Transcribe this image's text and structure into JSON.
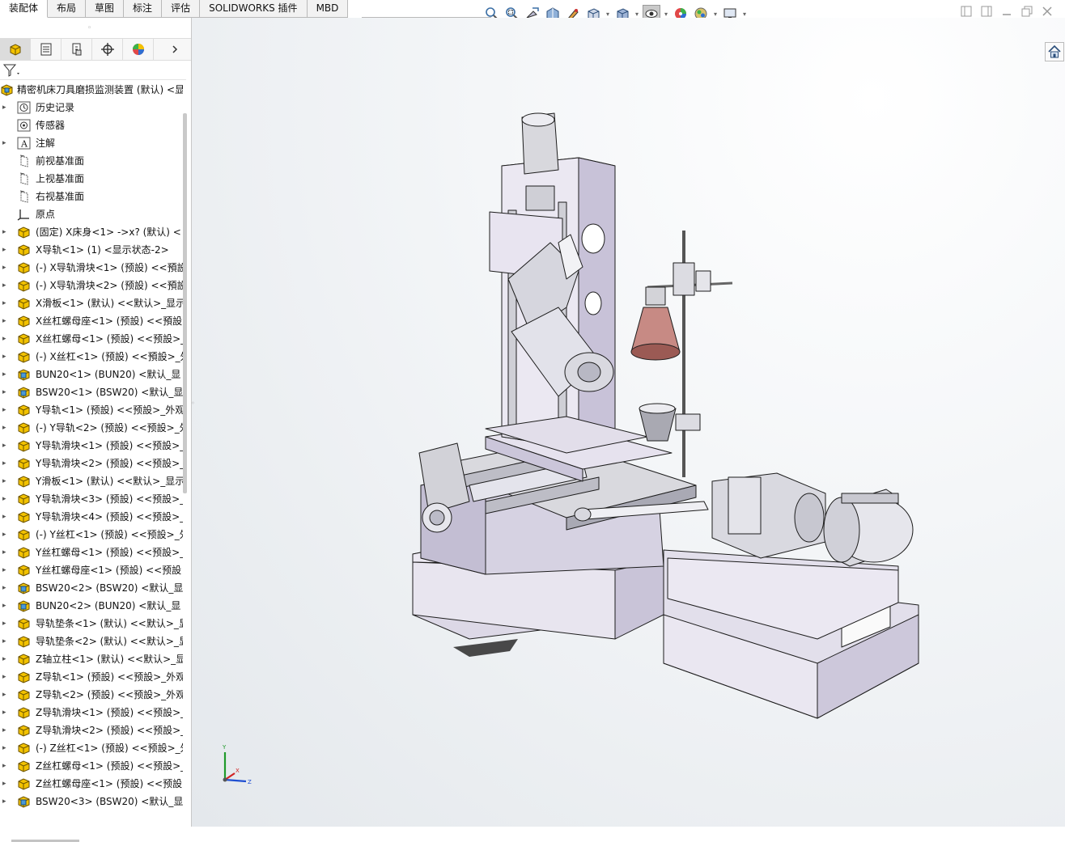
{
  "command_tabs": [
    "装配体",
    "布局",
    "草图",
    "标注",
    "评估",
    "SOLIDWORKS 插件",
    "MBD"
  ],
  "heads_up_toolbar": [
    "zoom-to-fit-icon",
    "zoom-to-area-icon",
    "previous-view-icon",
    "section-view-icon",
    "dynamic-annotation-icon",
    "view-orientation-icon",
    "display-style-icon",
    "hide-show-items-icon",
    "edit-appearance-icon",
    "apply-scene-icon",
    "view-settings-icon"
  ],
  "feature_tree": {
    "root": "精密机床刀具磨损监测装置 (默认) <显",
    "items": [
      {
        "label": "历史记录",
        "icon": "history",
        "expand": true
      },
      {
        "label": "传感器",
        "icon": "sensor",
        "expand": false
      },
      {
        "label": "注解",
        "icon": "annotation",
        "expand": true
      },
      {
        "label": "前视基准面",
        "icon": "plane",
        "expand": false
      },
      {
        "label": "上视基准面",
        "icon": "plane",
        "expand": false
      },
      {
        "label": "右视基准面",
        "icon": "plane",
        "expand": false
      },
      {
        "label": "原点",
        "icon": "origin",
        "expand": false
      },
      {
        "label": "(固定) X床身<1> ->x? (默认) <",
        "icon": "part",
        "expand": true
      },
      {
        "label": "X导轨<1> (1) <显示状态-2>",
        "icon": "part",
        "expand": true
      },
      {
        "label": "(-) X导轨滑块<1> (预設) <<預設",
        "icon": "part",
        "expand": true
      },
      {
        "label": "(-) X导轨滑块<2> (预設) <<預設",
        "icon": "part",
        "expand": true
      },
      {
        "label": "X滑板<1> (默认) <<默认>_显示",
        "icon": "part",
        "expand": true
      },
      {
        "label": "X丝杠螺母座<1> (预設) <<預設",
        "icon": "part",
        "expand": true
      },
      {
        "label": "X丝杠螺母<1> (预設) <<预設>_",
        "icon": "part",
        "expand": true
      },
      {
        "label": "(-) X丝杠<1> (预設) <<預設>_外",
        "icon": "part",
        "expand": true
      },
      {
        "label": "BUN20<1> (BUN20) <默认_显",
        "icon": "assembly",
        "expand": true
      },
      {
        "label": "BSW20<1> (BSW20) <默认_显",
        "icon": "assembly",
        "expand": true
      },
      {
        "label": "Y导轨<1> (预設) <<预設>_外观",
        "icon": "part",
        "expand": true
      },
      {
        "label": "(-) Y导轨<2> (预設) <<预設>_外",
        "icon": "part",
        "expand": true
      },
      {
        "label": "Y导轨滑块<1> (预設) <<预設>_",
        "icon": "part",
        "expand": true
      },
      {
        "label": "Y导轨滑块<2> (预設) <<预設>_",
        "icon": "part",
        "expand": true
      },
      {
        "label": "Y滑板<1> (默认) <<默认>_显示",
        "icon": "part",
        "expand": true
      },
      {
        "label": "Y导轨滑块<3> (预設) <<预設>_",
        "icon": "part",
        "expand": true
      },
      {
        "label": "Y导轨滑块<4> (预設) <<预設>_",
        "icon": "part",
        "expand": true
      },
      {
        "label": "(-) Y丝杠<1> (预設) <<预設>_外",
        "icon": "part",
        "expand": true
      },
      {
        "label": "Y丝杠螺母<1> (预設) <<预設>_",
        "icon": "part",
        "expand": true
      },
      {
        "label": "Y丝杠螺母座<1> (预設) <<预設",
        "icon": "part",
        "expand": true
      },
      {
        "label": "BSW20<2> (BSW20) <默认_显",
        "icon": "assembly",
        "expand": true
      },
      {
        "label": "BUN20<2> (BUN20) <默认_显",
        "icon": "assembly",
        "expand": true
      },
      {
        "label": "导轨垫条<1> (默认) <<默认>_显",
        "icon": "part",
        "expand": true
      },
      {
        "label": "导轨垫条<2> (默认) <<默认>_显",
        "icon": "part",
        "expand": true
      },
      {
        "label": "Z轴立柱<1> (默认) <<默认>_显",
        "icon": "part",
        "expand": true
      },
      {
        "label": "Z导轨<1> (预設) <<预設>_外观",
        "icon": "part",
        "expand": true
      },
      {
        "label": "Z导轨<2> (预設) <<预設>_外观",
        "icon": "part",
        "expand": true
      },
      {
        "label": "Z导轨滑块<1> (预設) <<预設>_",
        "icon": "part",
        "expand": true
      },
      {
        "label": "Z导轨滑块<2> (预設) <<预設>_",
        "icon": "part",
        "expand": true
      },
      {
        "label": "(-) Z丝杠<1> (预設) <<预設>_外",
        "icon": "part",
        "expand": true
      },
      {
        "label": "Z丝杠螺母<1> (预設) <<预設>_",
        "icon": "part",
        "expand": true
      },
      {
        "label": "Z丝杠螺母座<1> (预設) <<预設",
        "icon": "part",
        "expand": true
      },
      {
        "label": "BSW20<3> (BSW20) <默认_显",
        "icon": "assembly",
        "expand": true
      }
    ]
  },
  "triad": {
    "x": "X",
    "y": "Y",
    "z": "Z"
  },
  "colors": {
    "part_fill": "#e6e2ee",
    "part_edge": "#222222",
    "accent": "#f2c200",
    "selected_tab": "#ffffff"
  }
}
